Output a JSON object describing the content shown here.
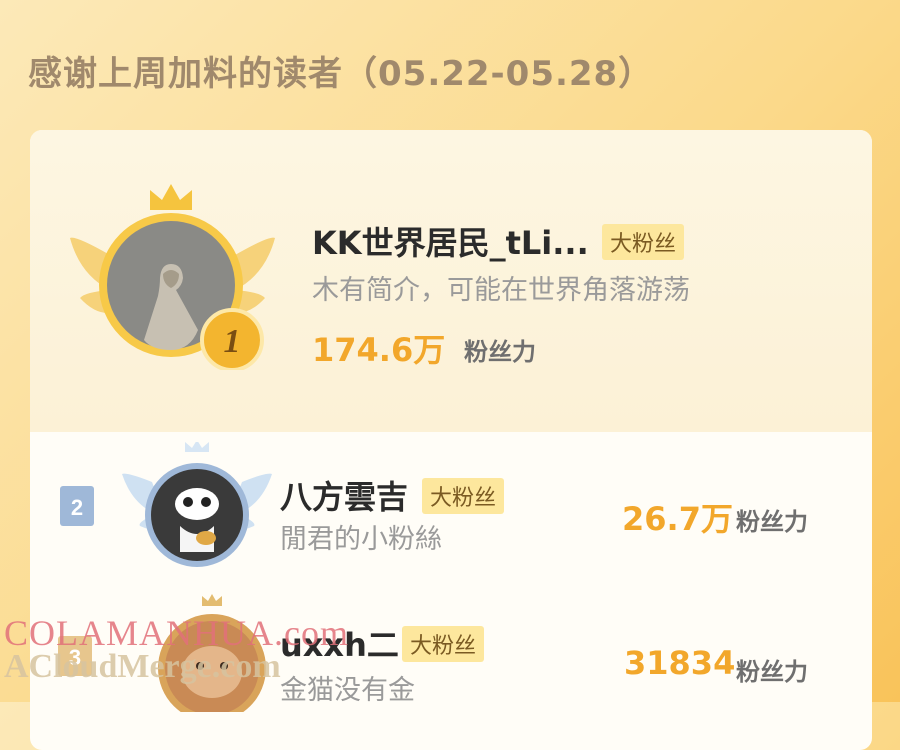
{
  "header": {
    "title": "感谢上周加料的读者（05.22-05.28）"
  },
  "entries": [
    {
      "rank": "1",
      "name": "KK世界居民_tLi...",
      "badge": "大粉丝",
      "intro": "木有简介，可能在世界角落游荡",
      "score": "174.6万",
      "score_label": "粉丝力"
    },
    {
      "rank": "2",
      "name": "八方雲吉",
      "badge": "大粉丝",
      "intro": "閒君的小粉絲",
      "score": "26.7万",
      "score_label": "粉丝力"
    },
    {
      "rank": "3",
      "name": "uxxh二",
      "badge": "大粉丝",
      "intro": "金猫没有金",
      "score": "31834",
      "score_label": "粉丝力"
    }
  ],
  "watermark": {
    "line1": "COLAMANHUA.com",
    "line2": "ACloudMerge.com"
  },
  "colors": {
    "accent": "#f2a72b",
    "badge_bg": "#fde79d",
    "title": "#a0896c"
  },
  "icons": {
    "crown": "crown-icon",
    "wings": "wings-icon"
  }
}
